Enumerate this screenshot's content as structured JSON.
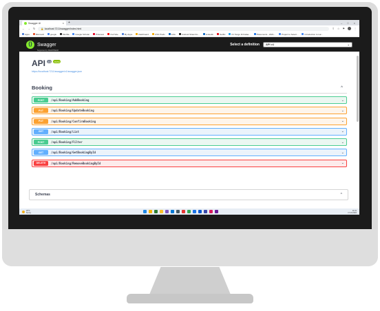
{
  "browser": {
    "tab_title": "Swagger UI",
    "new_tab_glyph": "+",
    "tab_close_glyph": "×",
    "window_controls": [
      "–",
      "□",
      "×"
    ],
    "url": "localhost:7211/swagger/index.html",
    "bookmarks": [
      {
        "label": "Apps",
        "color": "#4a7bd8"
      },
      {
        "label": "Microsoft",
        "color": "#e44d26"
      },
      {
        "label": "google",
        "color": "#4285f4"
      },
      {
        "label": "Mozilla",
        "color": "#222222"
      },
      {
        "label": "Google Scholar",
        "color": "#4285f4"
      },
      {
        "label": "Pinterest",
        "color": "#e60023"
      },
      {
        "label": "YouTube",
        "color": "#ff0000"
      },
      {
        "label": "My Apps",
        "color": "#4a7bd8"
      },
      {
        "label": "Dashboard",
        "color": "#f2a900"
      },
      {
        "label": "CSS Prefix",
        "color": "#f2a900"
      },
      {
        "label": "Jobs",
        "color": "#0a66c2"
      },
      {
        "label": "Android Shaw Do...",
        "color": "#222222"
      },
      {
        "label": "LinkedIn",
        "color": "#0a66c2"
      },
      {
        "label": "Netflix",
        "color": "#e50914"
      },
      {
        "label": "Fir Tango Di Kalaa...",
        "color": "#1da1f2"
      },
      {
        "label": "Placements - 2021...",
        "color": "#1a73e8"
      },
      {
        "label": "Project to Select...",
        "color": "#4285f4"
      },
      {
        "label": "Introduction to Lar...",
        "color": "#4285f4"
      }
    ]
  },
  "swagger": {
    "logo_glyph": "{}",
    "logo_text": "Swagger",
    "logo_subtext": "Supported by SMARTBEAR",
    "definition_label": "Select a definition",
    "definition_value": "API v1",
    "api_title": "API",
    "version_badge": "1.0",
    "oas_badge": "OAS3",
    "spec_link": "https://localhost:7211/swagger/v1/swagger.json",
    "tag": "Booking",
    "tag_chevron": "^",
    "operations": [
      {
        "method": "POST",
        "path": "/api/Booking/AddBooking",
        "kind": "post"
      },
      {
        "method": "PUT",
        "path": "/api/Booking/UpdateBooking",
        "kind": "put"
      },
      {
        "method": "PUT",
        "path": "/api/Booking/ConfirmBooking",
        "kind": "put"
      },
      {
        "method": "GET",
        "path": "/api/Booking/List",
        "kind": "get"
      },
      {
        "method": "POST",
        "path": "/api/Booking/Filter",
        "kind": "post"
      },
      {
        "method": "GET",
        "path": "/api/Booking/GetBookingById",
        "kind": "get"
      },
      {
        "method": "DELETE",
        "path": "/api/Booking/RemoveBookingById",
        "kind": "delete"
      }
    ],
    "op_chevron": "⌄",
    "schemas_title": "Schemas",
    "schemas_chevron": "^"
  },
  "taskbar": {
    "weather_temp": "29°C",
    "weather_desc": "Sunny",
    "time": "11:01",
    "date": "17-10-2022",
    "app_icon_colors": [
      "#1e88e5",
      "#f4b400",
      "#2e7d32",
      "#fbc02d",
      "#7e57c2",
      "#0078d4",
      "#455a64",
      "#e53935",
      "#34a853",
      "#1a73e8",
      "#0b57d0",
      "#3949ab",
      "#d81b60",
      "#6a1b9a"
    ]
  },
  "colors": {
    "post": "#49cc90",
    "put": "#fca130",
    "get": "#61affe",
    "delete": "#f93e3e",
    "swagger_green": "#85ea2d",
    "topbar": "#1b1b1b"
  }
}
